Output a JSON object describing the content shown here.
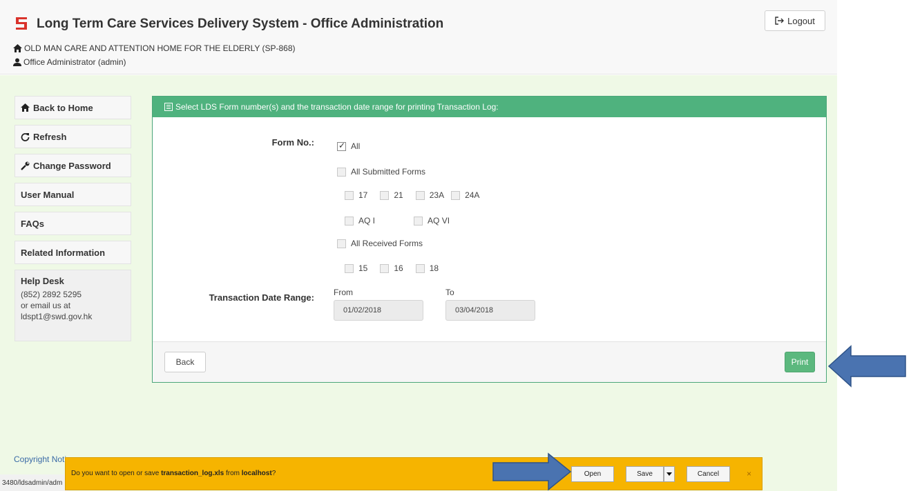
{
  "header": {
    "title": "Long Term Care Services Delivery System - Office Administration",
    "organization": "OLD MAN CARE AND ATTENTION HOME FOR THE ELDERLY (SP-868)",
    "user": "Office Administrator (admin)",
    "logout_label": "Logout"
  },
  "sidebar": {
    "items": [
      {
        "label": "Back to Home",
        "icon": "home-icon"
      },
      {
        "label": "Refresh",
        "icon": "refresh-icon"
      },
      {
        "label": "Change Password",
        "icon": "wrench-icon"
      },
      {
        "label": "User Manual",
        "icon": ""
      },
      {
        "label": "FAQs",
        "icon": ""
      },
      {
        "label": "Related Information",
        "icon": ""
      }
    ],
    "helpdesk": {
      "title": "Help Desk",
      "phone": "(852) 2892 5295",
      "email_prefix": "or email us at",
      "email": "ldspt1@swd.gov.hk"
    }
  },
  "panel": {
    "heading": "Select LDS Form number(s) and the transaction date range for printing Transaction Log:",
    "form_no_label": "Form No.:",
    "all_label": "All",
    "all_submitted_label": "All Submitted Forms",
    "submitted_forms": [
      "17",
      "21",
      "23A",
      "24A"
    ],
    "aq_forms": [
      "AQ I",
      "AQ VI"
    ],
    "all_received_label": "All Received Forms",
    "received_forms": [
      "15",
      "16",
      "18"
    ],
    "date_range_label": "Transaction Date Range:",
    "from_label": "From",
    "to_label": "To",
    "from_value": "01/02/2018",
    "to_value": "03/04/2018",
    "back_label": "Back",
    "print_label": "Print"
  },
  "footer": {
    "copyright": "Copyright Noti"
  },
  "statusbar": {
    "url": "3480/ldsadmin/adm"
  },
  "download_bar": {
    "prompt_prefix": "Do you want to open or save ",
    "file_name": "transaction_log.xls",
    "prompt_middle": " from ",
    "source": "localhost",
    "prompt_suffix": "?",
    "open_label": "Open",
    "save_label": "Save",
    "cancel_label": "Cancel",
    "close_glyph": "×"
  },
  "colors": {
    "panel_header": "#4fb27e",
    "content_bg": "#eff9e6",
    "download_bar": "#f6b400",
    "callout_arrow": "#4a73b0"
  }
}
